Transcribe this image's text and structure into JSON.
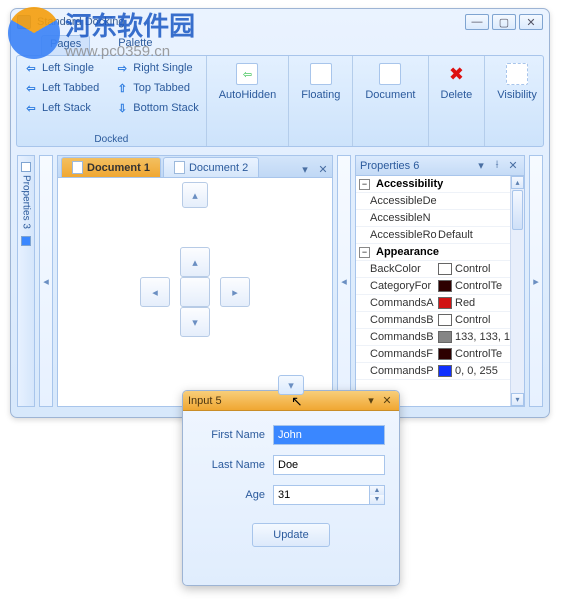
{
  "watermark": {
    "cn": "河东软件园",
    "url": "www.pc0359.cn"
  },
  "window": {
    "title": "Standard Docking"
  },
  "ribbon": {
    "tabs": {
      "pages": "Pages",
      "palette": "Palette"
    },
    "docked": {
      "label": "Docked",
      "left_single": "Left Single",
      "right_single": "Right Single",
      "left_tabbed": "Left Tabbed",
      "top_tabbed": "Top Tabbed",
      "left_stack": "Left Stack",
      "bottom_stack": "Bottom Stack"
    },
    "buttons": {
      "autohidden": "AutoHidden",
      "floating": "Floating",
      "document": "Document",
      "delete": "Delete",
      "visibility": "Visibility"
    }
  },
  "sidetab": {
    "label": "Properties 3"
  },
  "docs": {
    "d1": "Document 1",
    "d2": "Document 2"
  },
  "props": {
    "title": "Properties 6",
    "cat1": "Accessibility",
    "rows1": [
      {
        "k": "AccessibleDe",
        "v": ""
      },
      {
        "k": "AccessibleN",
        "v": ""
      },
      {
        "k": "AccessibleRo",
        "v": "Default"
      }
    ],
    "cat2": "Appearance",
    "rows2": [
      {
        "k": "BackColor",
        "c": "#ffffff",
        "v": "Control"
      },
      {
        "k": "CategoryFor",
        "c": "#2d0000",
        "v": "ControlTe"
      },
      {
        "k": "CommandsA",
        "c": "#d11313",
        "v": "Red"
      },
      {
        "k": "CommandsB",
        "c": "#ffffff",
        "v": "Control"
      },
      {
        "k": "CommandsB",
        "c": "#858585",
        "v": "133, 133, 1"
      },
      {
        "k": "CommandsF",
        "c": "#2d0000",
        "v": "ControlTe"
      },
      {
        "k": "CommandsP",
        "c": "#1030ff",
        "v": "0, 0, 255"
      }
    ]
  },
  "input": {
    "title": "Input 5",
    "fn_label": "First Name",
    "fn_val": "John",
    "ln_label": "Last Name",
    "ln_val": "Doe",
    "age_label": "Age",
    "age_val": "31",
    "update": "Update"
  }
}
